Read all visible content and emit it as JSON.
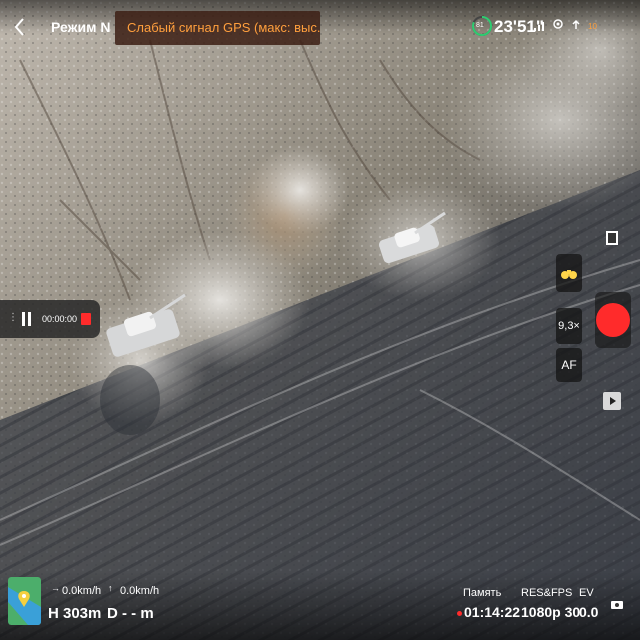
{
  "header": {
    "back_icon": "chevron-left-icon",
    "mode": "Режим N",
    "gps_warning": "Слабый сигнал GPS (макс: выс...",
    "battery_percent": "81",
    "flight_time": "23'51\"",
    "icons": [
      "signal-icon",
      "gps-icon",
      "antenna-icon"
    ],
    "satellite_count": "10"
  },
  "recording": {
    "time": "00:00:00"
  },
  "right_panel": {
    "lens_icon": "film-icon",
    "zoom": "9,3×",
    "focus": "AF",
    "binoculars_icon": "binoculars-icon",
    "shutter_icon": "record-button-icon",
    "playback_icon": "play-icon"
  },
  "telemetry": {
    "horizontal_speed": "0.0km/h",
    "vertical_speed": "0.0km/h",
    "height": "H 303m",
    "distance": "D - - m"
  },
  "camera_status": {
    "memory_label": "Память",
    "memory_value": "01:14:22",
    "res_label": "RES&FPS",
    "res_value": "1080p 30",
    "ev_label": "EV",
    "ev_value": "0.0"
  },
  "colors": {
    "warning": "#ff9f3d",
    "record_red": "#ff2b2b",
    "battery_green": "#2ecc71"
  }
}
